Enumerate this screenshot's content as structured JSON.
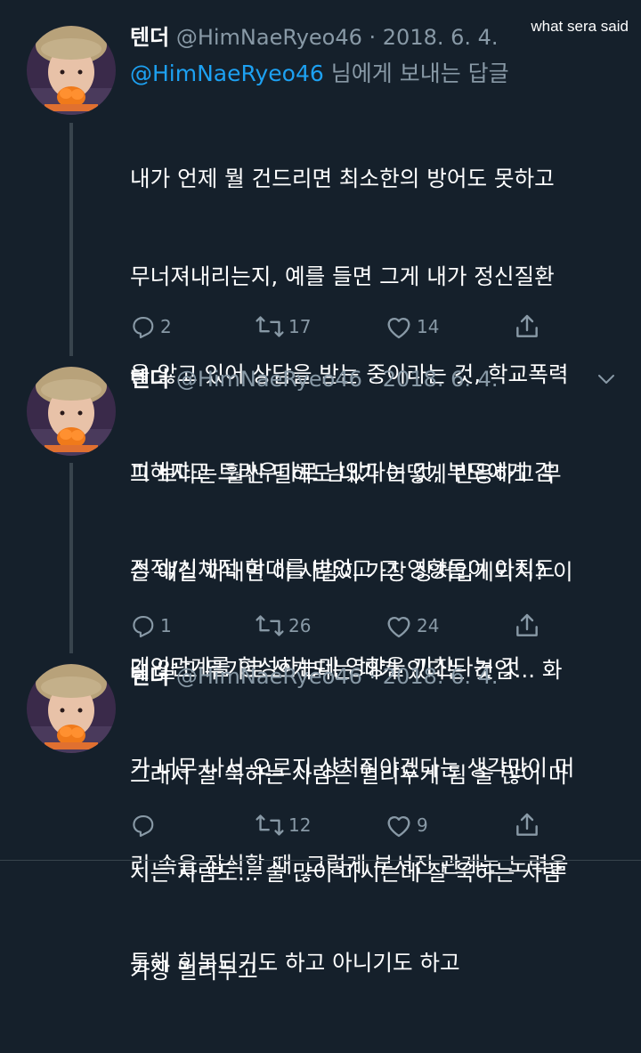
{
  "watermark": "what sera said",
  "colors": {
    "background": "#15202b",
    "text": "#ffffff",
    "secondary": "#8899a6",
    "accent": "#1da1f2",
    "divider": "#38444d"
  },
  "tweets": [
    {
      "name": "텐더",
      "handle": "@HimNaeRyeo46",
      "date": "· 2018. 6. 4.",
      "reply_to_mention": "@HimNaeRyeo46",
      "reply_to_suffix": " 님에게 보내는 답글",
      "body_lines": [
        "내가 언제 뭘 건드리면 최소한의 방어도 못하고",
        "무너져내리는지, 예를 들면 그게 내가 정신질환",
        "을 앓고 있어 상담을 받는 중이라는 것, 학교폭력",
        "피해자고 트라우마로 남았다는 것, 부모에게 감",
        "정적/신체적 학대를 받았고 그 영향들이 아직도",
        "대인관계를 형성하는데 영향을 끼친다는 것"
      ],
      "replies": "2",
      "retweets": "17",
      "likes": "14"
    },
    {
      "name": "텐더",
      "handle": "@HimNaeRyeo46",
      "date": "· 2018. 6. 4.",
      "body_lines": [
        "그 보다는 훨씬 덜해도 내가 어떻게 반응하고 무",
        "슨 얘길 꺼내면 이 사람이 가장 상처입게되지? 이",
        "걸 알고 무기로 쓰게되는 때가 있다는 것임... 화",
        "가 너무 나서 오로지 상처줘야겠다는 생각만이 머",
        "리 속을 잠식할 때. 그렇게 부서진 관계는 노력을",
        "통해 회복되기도 하고 아니기도 하고"
      ],
      "replies": "1",
      "retweets": "26",
      "likes": "24"
    },
    {
      "name": "텐더",
      "handle": "@HimNaeRyeo46",
      "date": "· 2018. 6. 4.",
      "body_lines": [
        "그래서 잘 욱하는 사람은 멀리두게 됨 술 많이 마",
        "시는 사람도... 술 많이 마시는데 잘 욱하는 사람",
        "가장 멀리두고"
      ],
      "replies": "",
      "retweets": "12",
      "likes": "9"
    }
  ],
  "icons": {
    "reply": "reply-icon",
    "retweet": "retweet-icon",
    "like": "heart-icon",
    "share": "share-icon",
    "caret": "chevron-down-icon"
  }
}
